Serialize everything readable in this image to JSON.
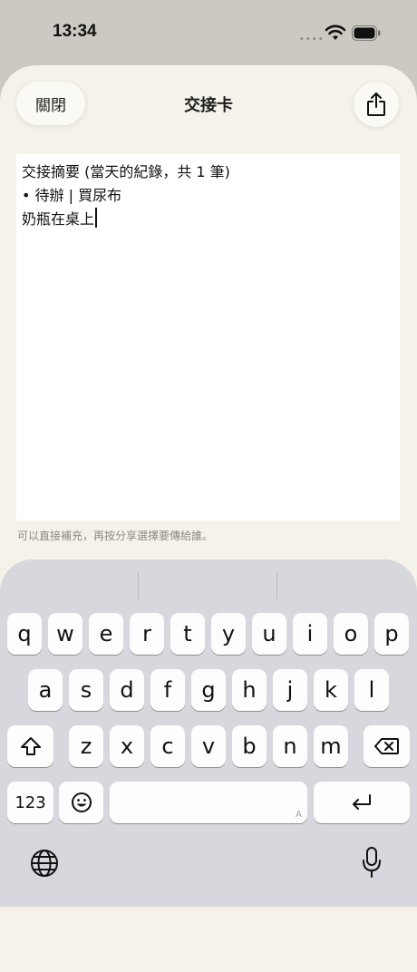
{
  "status": {
    "time": "13:34",
    "dots": "••••"
  },
  "header": {
    "close_label": "關閉",
    "title": "交接卡"
  },
  "note": {
    "lines": [
      "交接摘要 (當天的紀錄，共 1 筆)",
      "• 待辦 | 買尿布",
      "奶瓶在桌上"
    ]
  },
  "hint": "可以直接補充，再按分享選擇要傳給誰。",
  "keyboard": {
    "row1": [
      "q",
      "w",
      "e",
      "r",
      "t",
      "y",
      "u",
      "i",
      "o",
      "p"
    ],
    "row2": [
      "a",
      "s",
      "d",
      "f",
      "g",
      "h",
      "j",
      "k",
      "l"
    ],
    "row3": [
      "z",
      "x",
      "c",
      "v",
      "b",
      "n",
      "m"
    ],
    "numbers_label": "123",
    "space_mark": "A"
  }
}
